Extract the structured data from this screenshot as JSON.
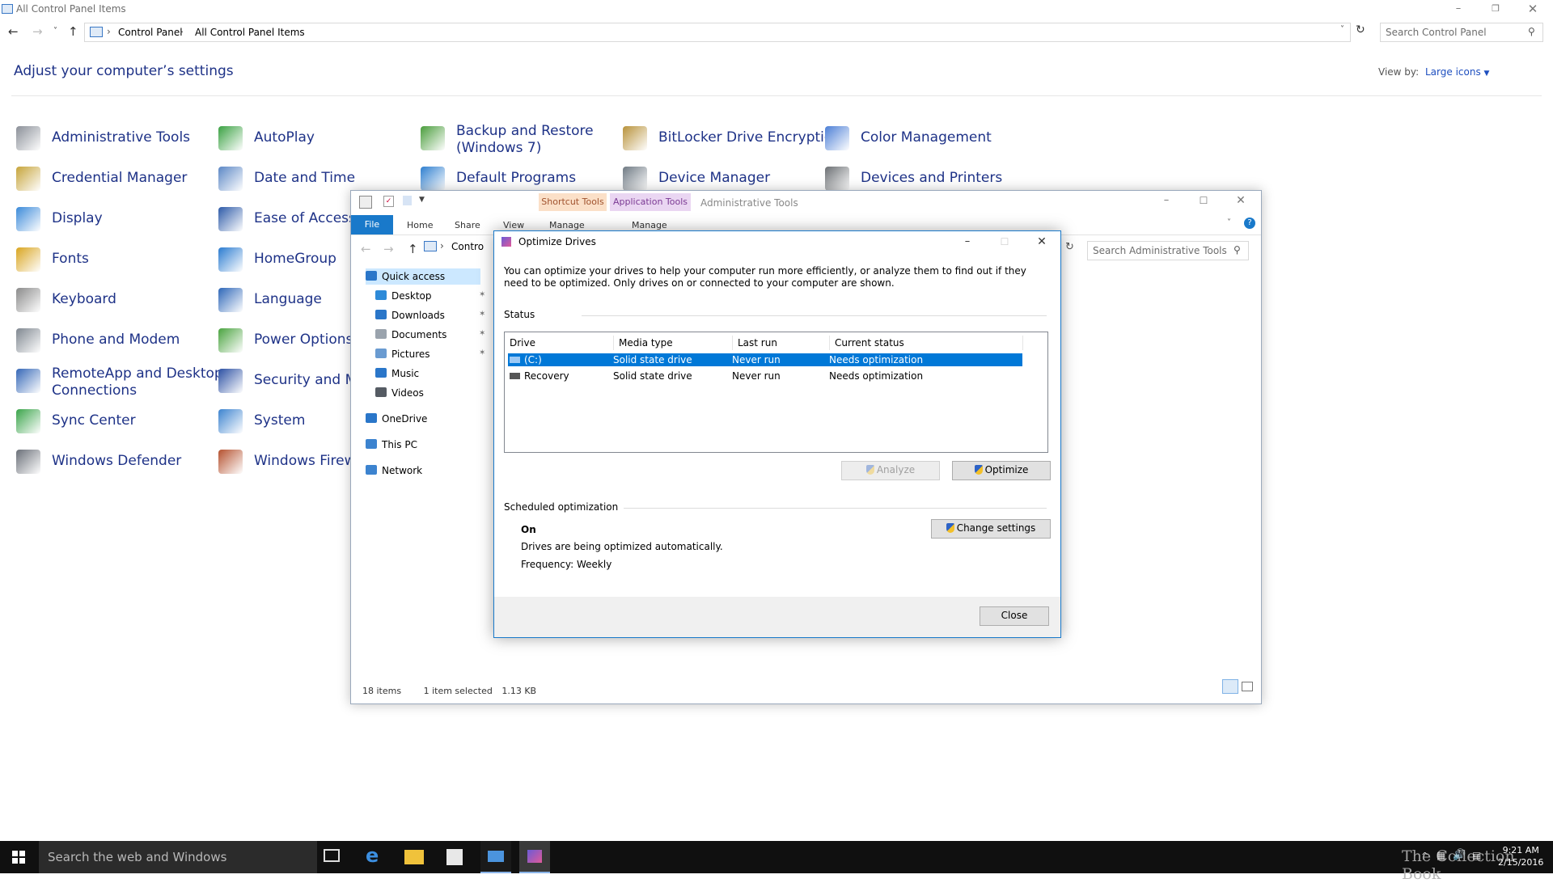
{
  "control_panel": {
    "title": "All Control Panel Items",
    "breadcrumb": [
      "Control Panel",
      "All Control Panel Items"
    ],
    "search_placeholder": "Search Control Panel",
    "heading": "Adjust your computer’s settings",
    "view_by_label": "View by:",
    "view_by_value": "Large icons",
    "items": [
      {
        "label": "Administrative Tools",
        "icon": "administrative-tools-icon",
        "color": "#8a8f98"
      },
      {
        "label": "AutoPlay",
        "icon": "autoplay-icon",
        "color": "#3aa142"
      },
      {
        "label": "Backup and Restore",
        "label2": "(Windows 7)",
        "icon": "backup-restore-icon",
        "color": "#4a9d3c"
      },
      {
        "label": "BitLocker Drive Encryption",
        "icon": "bitlocker-icon",
        "color": "#b8923a"
      },
      {
        "label": "Color Management",
        "icon": "color-management-icon",
        "color": "#4c7fd6"
      },
      {
        "label": "Credential Manager",
        "icon": "credential-manager-icon",
        "color": "#c6a43a"
      },
      {
        "label": "Date and Time",
        "icon": "date-time-icon",
        "color": "#5b87c5"
      },
      {
        "label": "Default Programs",
        "icon": "default-programs-icon",
        "color": "#2f7fcf"
      },
      {
        "label": "Device Manager",
        "icon": "device-manager-icon",
        "color": "#6f7a84"
      },
      {
        "label": "Devices and Printers",
        "icon": "devices-printers-icon",
        "color": "#6b6f73"
      },
      {
        "label": "Display",
        "icon": "display-icon",
        "color": "#3b8ad9"
      },
      {
        "label": "Ease of Access Ce",
        "icon": "ease-of-access-icon",
        "color": "#2d5aa8"
      },
      {
        "label": "Fonts",
        "icon": "fonts-icon",
        "color": "#d9a520"
      },
      {
        "label": "HomeGroup",
        "icon": "homegroup-icon",
        "color": "#2a7bd0"
      },
      {
        "label": "Keyboard",
        "icon": "keyboard-icon",
        "color": "#8a8a8a"
      },
      {
        "label": "Language",
        "icon": "language-icon",
        "color": "#2d66b8"
      },
      {
        "label": "Phone and Modem",
        "icon": "phone-modem-icon",
        "color": "#7f8790"
      },
      {
        "label": "Power Options",
        "icon": "power-options-icon",
        "color": "#4aa33f"
      },
      {
        "label": "RemoteApp and Desktop",
        "label2": "Connections",
        "icon": "remoteapp-icon",
        "color": "#3567b7"
      },
      {
        "label": "Security and Mair",
        "icon": "security-maintenance-icon",
        "color": "#2b4fa3"
      },
      {
        "label": "Sync Center",
        "icon": "sync-center-icon",
        "color": "#3aa44a"
      },
      {
        "label": "System",
        "icon": "system-icon",
        "color": "#3c83cf"
      },
      {
        "label": "Windows Defender",
        "icon": "windows-defender-icon",
        "color": "#6a6f78"
      },
      {
        "label": "Windows Firewall",
        "icon": "windows-firewall-icon",
        "color": "#b5512f"
      }
    ]
  },
  "explorer": {
    "context_tabs": [
      {
        "group": "Shortcut Tools",
        "tab": "Manage",
        "color": "#fbe0c8",
        "text_color": "#a0522d"
      },
      {
        "group": "Application Tools",
        "tab": "Manage",
        "color": "#ead6f2",
        "text_color": "#7b3a94"
      }
    ],
    "title": "Administrative Tools",
    "ribbon_tabs": [
      "File",
      "Home",
      "Share",
      "View"
    ],
    "breadcrumb_fragment": "Contro",
    "search_placeholder": "Search Administrative Tools",
    "sidebar": [
      {
        "label": "Quick access",
        "icon": "star-icon",
        "color": "#2a76c9",
        "pinned": false,
        "selected": true
      },
      {
        "label": "Desktop",
        "icon": "desktop-folder-icon",
        "color": "#2d8ad8",
        "pinned": true
      },
      {
        "label": "Downloads",
        "icon": "downloads-folder-icon",
        "color": "#2a76c9",
        "pinned": true
      },
      {
        "label": "Documents",
        "icon": "documents-folder-icon",
        "color": "#9aa3ad",
        "pinned": true
      },
      {
        "label": "Pictures",
        "icon": "pictures-folder-icon",
        "color": "#6a9bd1",
        "pinned": true
      },
      {
        "label": "Music",
        "icon": "music-folder-icon",
        "color": "#2a76c9",
        "pinned": false
      },
      {
        "label": "Videos",
        "icon": "videos-folder-icon",
        "color": "#555b63",
        "pinned": false
      },
      {
        "label": "OneDrive",
        "icon": "onedrive-icon",
        "color": "#2a76c9",
        "pinned": false
      },
      {
        "label": "This PC",
        "icon": "this-pc-icon",
        "color": "#3c83cf",
        "pinned": false
      },
      {
        "label": "Network",
        "icon": "network-icon",
        "color": "#3c83cf",
        "pinned": false
      }
    ],
    "status": {
      "items": "18 items",
      "selected": "1 item selected",
      "size": "1.13 KB"
    }
  },
  "dialog": {
    "title": "Optimize Drives",
    "description": "You can optimize your drives to help your computer run more efficiently, or analyze them to find out if they need to be optimized. Only drives on or connected to your computer are shown.",
    "status_label": "Status",
    "columns": [
      "Drive",
      "Media type",
      "Last run",
      "Current status"
    ],
    "drives": [
      {
        "drive": "(C:)",
        "media": "Solid state drive",
        "last_run": "Never run",
        "status": "Needs optimization",
        "selected": true
      },
      {
        "drive": "Recovery",
        "media": "Solid state drive",
        "last_run": "Never run",
        "status": "Needs optimization",
        "selected": false
      }
    ],
    "analyze_label": "Analyze",
    "optimize_label": "Optimize",
    "scheduled_label": "Scheduled optimization",
    "schedule_state": "On",
    "schedule_desc": "Drives are being optimized automatically.",
    "schedule_freq": "Frequency: Weekly",
    "change_settings_label": "Change settings",
    "close_label": "Close"
  },
  "taskbar": {
    "search_placeholder": "Search the web and Windows",
    "time": "9:21 AM",
    "date": "2/15/2016",
    "watermark": "The Collection Book"
  }
}
